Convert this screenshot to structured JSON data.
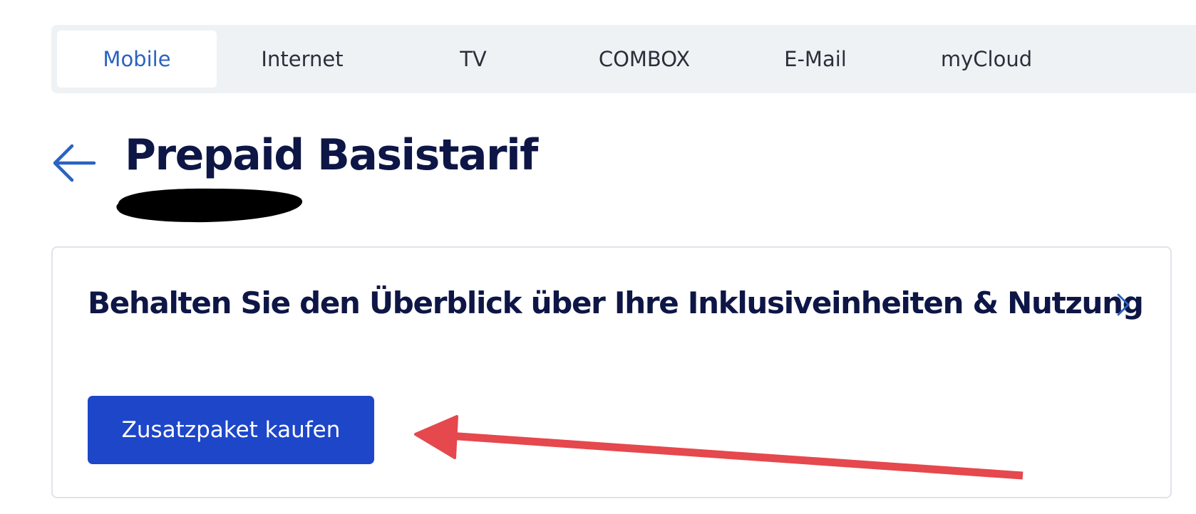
{
  "nav": {
    "tabs": [
      {
        "label": "Mobile",
        "active": true
      },
      {
        "label": "Internet",
        "active": false
      },
      {
        "label": "TV",
        "active": false
      },
      {
        "label": "COMBOX",
        "active": false
      },
      {
        "label": "E-Mail",
        "active": false
      },
      {
        "label": "myCloud",
        "active": false
      }
    ]
  },
  "header": {
    "back_icon": "arrow-left-icon",
    "title": "Prepaid Basistarif"
  },
  "card": {
    "heading": "Behalten Sie den Überblick über Ihre Inklusiveinheiten & Nutzung",
    "chevron_icon": "chevron-right-icon",
    "button_label": "Zusatzpaket kaufen"
  },
  "colors": {
    "accent": "#2a63c0",
    "primary_button": "#1d46c8",
    "heading_text": "#0d1645",
    "tabbar_bg": "#eff2f5",
    "annotation_arrow": "#e5484d"
  }
}
